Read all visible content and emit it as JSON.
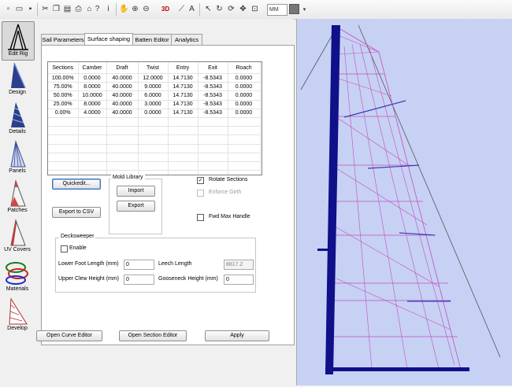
{
  "toolbar": {
    "label_3d": "3D",
    "unit_value": "MM"
  },
  "rail": {
    "items": [
      {
        "label": "Edit Rig"
      },
      {
        "label": "Design"
      },
      {
        "label": "Details"
      },
      {
        "label": "Panels"
      },
      {
        "label": "Patches"
      },
      {
        "label": "UV Covers"
      },
      {
        "label": "Materials"
      },
      {
        "label": "Develop"
      }
    ]
  },
  "tabs": [
    "Sail Parameters",
    "Surface shaping",
    "Batten Editor",
    "Analytics"
  ],
  "grid": {
    "columns": [
      "Sections",
      "Camber",
      "Draft",
      "Twist",
      "Entry",
      "Exit",
      "Roach"
    ],
    "rows": [
      [
        "100.00%",
        "0.0000",
        "40.0000",
        "12.0000",
        "14.7130",
        "-8.5343",
        "0.0000"
      ],
      [
        "75.00%",
        "8.0000",
        "40.0000",
        "9.0000",
        "14.7130",
        "-8.5343",
        "0.0000"
      ],
      [
        "50.00%",
        "10.0000",
        "40.0000",
        "6.0000",
        "14.7130",
        "-8.5343",
        "0.0000"
      ],
      [
        "25.00%",
        "8.0000",
        "40.0000",
        "3.0000",
        "14.7130",
        "-8.5343",
        "0.0000"
      ],
      [
        "0.00%",
        "4.0000",
        "40.0000",
        "0.0000",
        "14.7130",
        "-8.5343",
        "0.0000"
      ]
    ]
  },
  "buttons": {
    "quickedit": "Quickedit...",
    "export_csv": "Export to CSV",
    "import": "Import",
    "export": "Export",
    "open_curve_editor": "Open Curve Editor",
    "open_section_editor": "Open Section Editor",
    "apply": "Apply"
  },
  "mold_library": {
    "title": "Mold Library"
  },
  "options": {
    "rotate_sections": {
      "label": "Rotate Sections",
      "checked": true
    },
    "enforce_girth": {
      "label": "Enforce Girth",
      "checked": false
    },
    "fwd_max_handle": {
      "label": "Fwd Max Handle",
      "checked": false
    }
  },
  "decksweeper": {
    "title": "Decksweeper",
    "enable_label": "Enable",
    "lower_foot_label": "Lower Foot Length (mm)",
    "lower_foot_value": "0",
    "upper_clew_label": "Upper Clew Height (mm)",
    "upper_clew_value": "0",
    "leech_label": "Leech Length",
    "leech_value": "8817.2",
    "gooseneck_label": "Gooseneck Height (mm)",
    "gooseneck_value": "0"
  },
  "colors": {
    "viewport_bg": "#c7d1f4",
    "mast": "#10108a",
    "sail_lines": "#c050c0",
    "batten_lines": "#3a3ab0"
  }
}
